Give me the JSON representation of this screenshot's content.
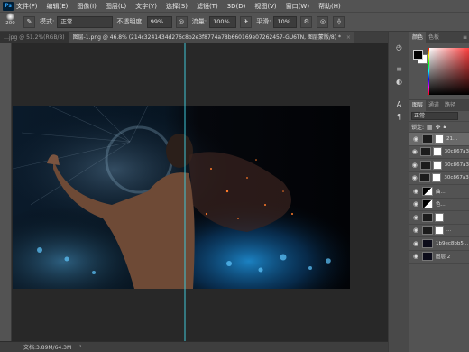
{
  "app": {
    "logo": "Ps"
  },
  "menubar": {
    "items": [
      "文件(F)",
      "编辑(E)",
      "图像(I)",
      "图层(L)",
      "文字(Y)",
      "选择(S)",
      "滤镜(T)",
      "3D(D)",
      "视图(V)",
      "窗口(W)",
      "帮助(H)"
    ]
  },
  "options": {
    "brush_size": "200",
    "mode_label": "模式:",
    "mode_value": "正常",
    "opacity_label": "不透明度:",
    "opacity_value": "99%",
    "flow_label": "流量:",
    "flow_value": "100%",
    "smooth_label": "平滑:",
    "smooth_value": "10%"
  },
  "tabs": [
    {
      "label": "…jpg @ 51.2%(RGB/8)",
      "active": false
    },
    {
      "label": "图层-1.png @ 46.8% (214c3241434d276c8b2e3f8774a78b660169e07262457-GU6TN, 图层蒙版/8) *",
      "active": true
    }
  ],
  "status": {
    "doc_info": "文档:3.89M/64.3M",
    "arrow": "›"
  },
  "panel": {
    "color_tabs": [
      "颜色",
      "色板"
    ],
    "color_menu": "≡",
    "layer_tabs": [
      "图层",
      "通道",
      "路径"
    ],
    "blend_mode": "正常",
    "lock_label": "锁定:",
    "layers": [
      {
        "name": "21...",
        "thumb": "black",
        "mask": true,
        "selected": true
      },
      {
        "name": "30c867a36...",
        "thumb": "black",
        "mask": true,
        "selected": false
      },
      {
        "name": "30c867a36...",
        "thumb": "black",
        "mask": true,
        "selected": false
      },
      {
        "name": "30c867a36f...",
        "thumb": "black",
        "mask": true,
        "selected": false
      },
      {
        "name": "曲...",
        "thumb": "mix",
        "mask": false,
        "selected": false
      },
      {
        "name": "色...",
        "thumb": "mix",
        "mask": false,
        "selected": false
      },
      {
        "name": "...",
        "thumb": "black",
        "mask": true,
        "selected": false
      },
      {
        "name": "...",
        "thumb": "black",
        "mask": true,
        "selected": false
      },
      {
        "name": "1b9ec8bb5...",
        "thumb": "dark",
        "mask": false,
        "selected": false
      },
      {
        "name": "图层 2",
        "thumb": "dark",
        "mask": false,
        "selected": false
      }
    ]
  },
  "colors": {
    "fg": "#000000",
    "bg": "#ffffff",
    "guide": "#3fc6d6"
  }
}
